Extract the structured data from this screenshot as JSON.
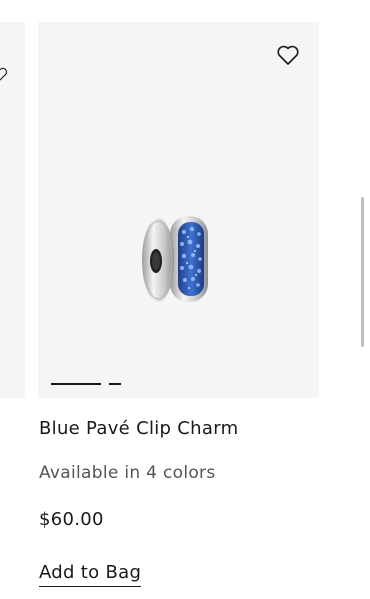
{
  "product": {
    "title": "Blue Pavé Clip Charm",
    "availability": "Available in 4 colors",
    "price": "$60.00",
    "add_to_bag_label": "Add to Bag"
  },
  "carousel": {
    "image_count": 2,
    "active_index": 0
  },
  "icons": {
    "wishlist": "heart-outline-icon"
  },
  "colors": {
    "card_background": "#f5f5f5",
    "text": "#1a1a1a",
    "muted_text": "#555555",
    "gem_blue": "#2f5fb8"
  }
}
